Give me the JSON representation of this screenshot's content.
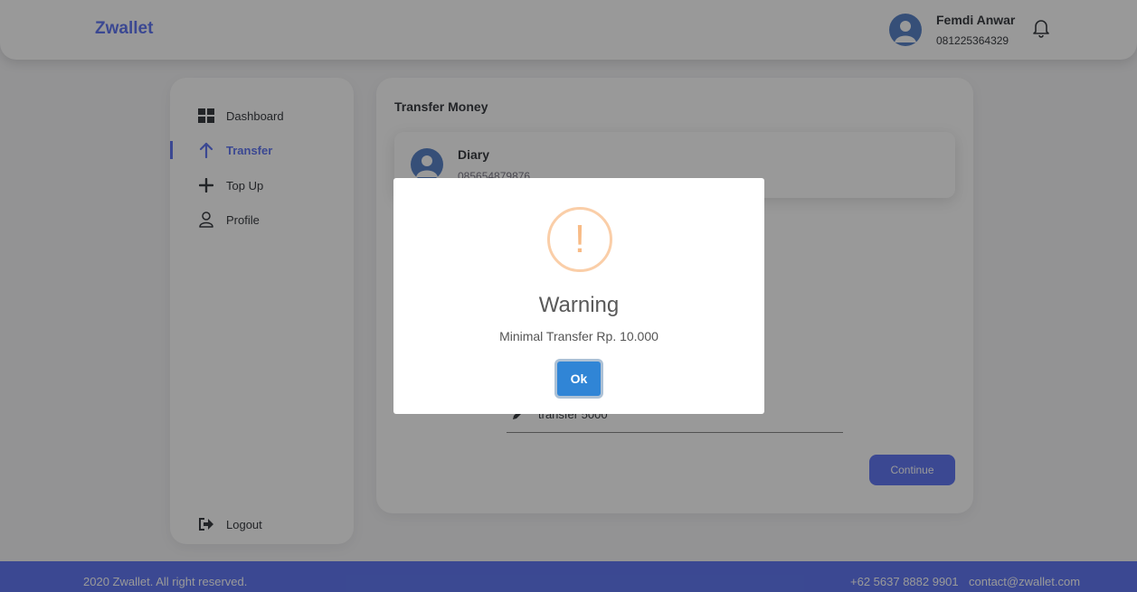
{
  "header": {
    "brand": "Zwallet",
    "user_name": "Femdi Anwar",
    "user_phone": "081225364329",
    "icons": [
      "user-avatar-icon",
      "bell-icon"
    ]
  },
  "sidebar": {
    "items": [
      {
        "label": "Dashboard",
        "icon": "dashboard-grid-icon",
        "active": false
      },
      {
        "label": "Transfer",
        "icon": "arrow-up-icon",
        "active": true
      },
      {
        "label": "Top Up",
        "icon": "plus-icon",
        "active": false
      },
      {
        "label": "Profile",
        "icon": "user-icon",
        "active": false
      }
    ],
    "logout_label": "Logout"
  },
  "main": {
    "title": "Transfer Money",
    "contact": {
      "name": "Diary",
      "phone": "085654879876"
    },
    "note_value": "transfer 5000",
    "continue_label": "Continue"
  },
  "footer": {
    "copyright": "2020 Zwallet. All right reserved.",
    "phone": "+62 5637 8882 9901",
    "email": "contact@zwallet.com"
  },
  "modal": {
    "icon_symbol": "!",
    "title": "Warning",
    "text": "Minimal Transfer Rp. 10.000",
    "ok_label": "Ok"
  },
  "colors": {
    "primary": "#6379F4",
    "warning": "#f8bb86",
    "ok_button": "#3085d6"
  }
}
